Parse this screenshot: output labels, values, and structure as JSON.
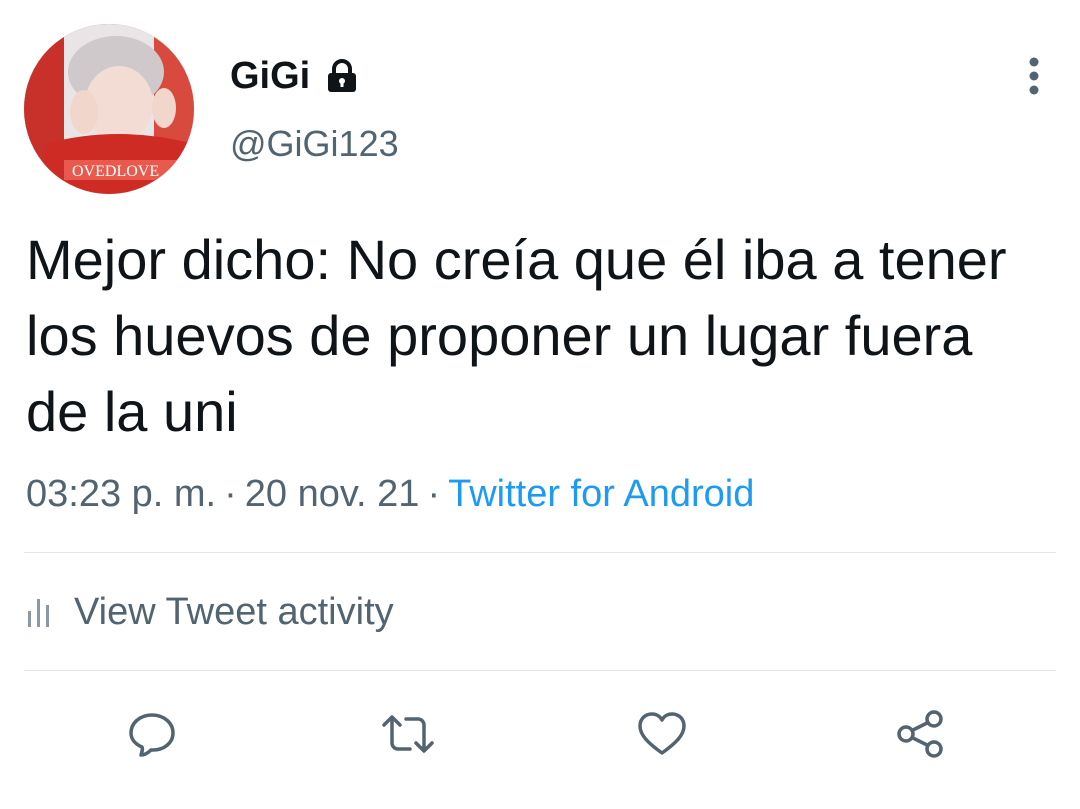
{
  "user": {
    "display_name": "GiGi",
    "handle": "@GiGi123",
    "protected_icon": "lock-icon",
    "avatar_icon": "avatar-photo"
  },
  "tweet": {
    "text": "Mejor dicho: No creía que él iba a tener los huevos de proponer un lugar fuera de la uni",
    "time": "03:23 p. m.",
    "separator": "·",
    "date": "20 nov. 21",
    "source": "Twitter for Android"
  },
  "activity": {
    "label": "View Tweet activity",
    "icon": "bar-chart-icon"
  },
  "actions": [
    {
      "name": "reply",
      "icon": "reply-icon"
    },
    {
      "name": "retweet",
      "icon": "retweet-icon"
    },
    {
      "name": "like",
      "icon": "heart-icon"
    },
    {
      "name": "share",
      "icon": "share-icon"
    }
  ],
  "colors": {
    "text_primary": "#0f1419",
    "text_secondary": "#536471",
    "link": "#1d9bf0",
    "divider": "#e3e6e8"
  }
}
